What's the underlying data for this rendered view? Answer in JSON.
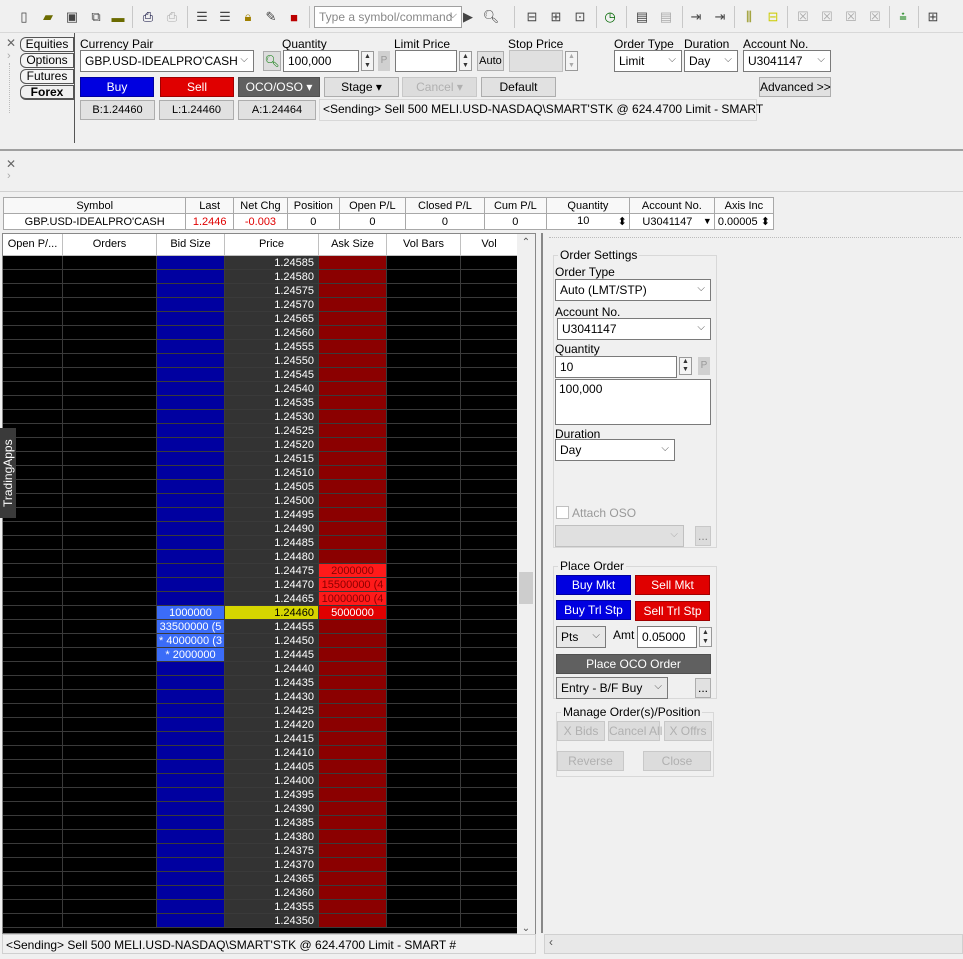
{
  "toolbar": {
    "left_icons": [
      "new-page-icon",
      "open-folder-icon",
      "save-all-icon",
      "new-window-icon",
      "open-layout-icon",
      "print-icon",
      "print-disabled-icon",
      "layout-a-icon",
      "layout-b-icon",
      "lock-icon",
      "pen-tool-icon",
      "color-cubes-icon"
    ],
    "symbol_placeholder": "Type a symbol/command",
    "right_icons": [
      "search-chart-icon",
      "export-a-icon",
      "export-b-icon",
      "export-c-icon",
      "calendar-clock-icon",
      "document-icon",
      "document-disabled-icon",
      "arrow-t-icon",
      "arrow-a-icon",
      "column-insert-icon",
      "column-yellow-icon",
      "x-b-icon",
      "x-a-icon",
      "x-c-icon",
      "x-five-icon",
      "vp-icon",
      "add-list-icon"
    ]
  },
  "order_entry": {
    "tabs": [
      "Equities",
      "Options",
      "Futures",
      "Forex"
    ],
    "active_tab": "Forex",
    "labels": {
      "currency_pair": "Currency Pair",
      "quantity": "Quantity",
      "limit_price": "Limit Price",
      "stop_price": "Stop Price",
      "order_type": "Order Type",
      "duration": "Duration",
      "account": "Account No."
    },
    "currency_pair": "GBP.USD-IDEALPRO'CASH",
    "quantity": "100,000",
    "limit_price": "",
    "stop_price": "",
    "order_type": "Limit",
    "duration": "Day",
    "account": "U3041147",
    "p_label": "P",
    "auto_label": "Auto",
    "buy_label": "Buy",
    "sell_label": "Sell",
    "oco_label": "OCO/OSO ▾",
    "stage_label": "Stage",
    "cancel_label": "Cancel",
    "default_label": "Default",
    "advanced_label": "Advanced >>",
    "bid_text": "B:1.24460",
    "last_text": "L:1.24460",
    "ask_text": "A:1.24464",
    "message": "<Sending> Sell 500 MELI.USD-NASDAQ\\SMART'STK @ 624.4700 Limit - SMART"
  },
  "quote_row": {
    "headers": [
      "Symbol",
      "Last",
      "Net Chg",
      "Position",
      "Open P/L",
      "Closed P/L",
      "Cum P/L",
      "Quantity",
      "Account No.",
      "Axis Inc"
    ],
    "values": [
      "GBP.USD-IDEALPRO'CASH",
      "1.2446",
      "-0.003",
      "0",
      "0",
      "0",
      "0",
      "10",
      "U3041147",
      "0.00005"
    ]
  },
  "ladder": {
    "headers": [
      "Open P/...",
      "Orders",
      "Bid Size",
      "Price",
      "Ask Size",
      "Vol Bars",
      "Vol"
    ],
    "current_price": "1.24460",
    "prices": [
      "1.24585",
      "1.24580",
      "1.24575",
      "1.24570",
      "1.24565",
      "1.24560",
      "1.24555",
      "1.24550",
      "1.24545",
      "1.24540",
      "1.24535",
      "1.24530",
      "1.24525",
      "1.24520",
      "1.24515",
      "1.24510",
      "1.24505",
      "1.24500",
      "1.24495",
      "1.24490",
      "1.24485",
      "1.24480",
      "1.24475",
      "1.24470",
      "1.24465",
      "1.24460",
      "1.24455",
      "1.24450",
      "1.24445",
      "1.24440",
      "1.24435",
      "1.24430",
      "1.24425",
      "1.24420",
      "1.24415",
      "1.24410",
      "1.24405",
      "1.24400",
      "1.24395",
      "1.24390",
      "1.24385",
      "1.24380",
      "1.24375",
      "1.24370",
      "1.24365",
      "1.24360",
      "1.24355",
      "1.24350"
    ],
    "bids": {
      "1.24460": "1000000",
      "1.24455": "33500000  (5",
      "1.24450": "* 4000000  (3",
      "1.24445": "* 2000000"
    },
    "asks": {
      "1.24475": "2000000",
      "1.24470": "15500000  (4",
      "1.24465": "10000000  (4",
      "1.24460": "5000000"
    },
    "side_tab": "TradingApps"
  },
  "status_bar": "<Sending> Sell 500 MELI.USD-NASDAQ\\SMART'STK @ 624.4700 Limit - SMART #",
  "order_panel": {
    "settings_legend": "Order Settings",
    "order_type_label": "Order Type",
    "order_type": "Auto (LMT/STP)",
    "account_label": "Account No.",
    "account": "U3041147",
    "quantity_label": "Quantity",
    "quantity": "10",
    "quantity_note": "100,000",
    "duration_label": "Duration",
    "duration": "Day",
    "attach_oso": "Attach OSO",
    "ellipsis": "...",
    "place_legend": "Place Order",
    "buy_mkt": "Buy Mkt",
    "sell_mkt": "Sell Mkt",
    "buy_trl": "Buy Trl Stp",
    "sell_trl": "Sell Trl Stp",
    "pts": "Pts",
    "amt_label": "Amt",
    "amt": "0.05000",
    "place_oco": "Place OCO Order",
    "entry": "Entry - B/F Buy",
    "manage_legend": "Manage Order(s)/Position",
    "x_bids": "X Bids",
    "cancel_all": "Cancel All",
    "x_offers": "X Offrs",
    "reverse": "Reverse",
    "close": "Close"
  },
  "colors": {
    "buy": "#0000e0",
    "sell": "#e00000",
    "bid_col": "#0000a0",
    "ask_col": "#8b0000",
    "current": "#d6d600"
  }
}
